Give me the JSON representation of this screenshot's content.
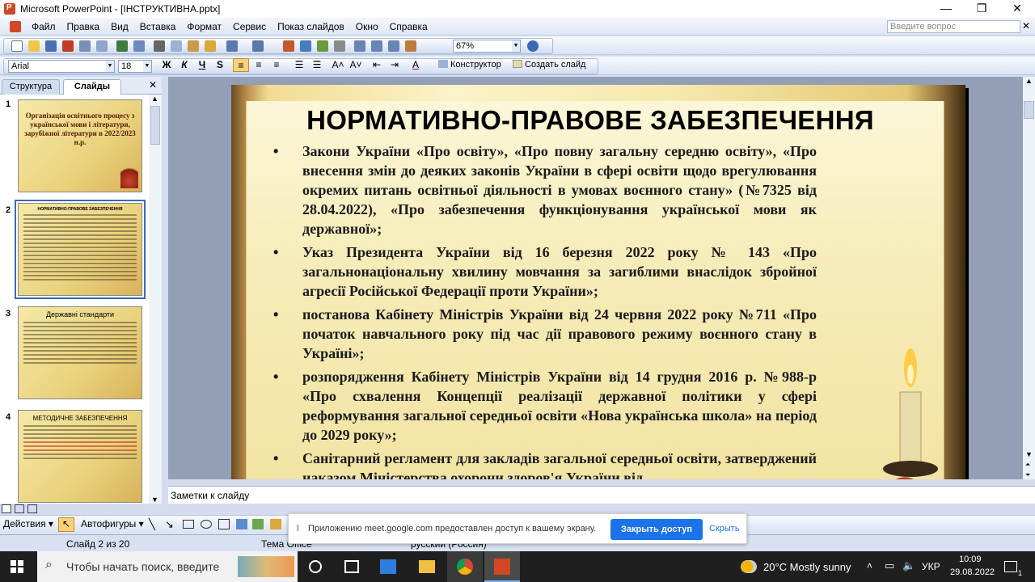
{
  "window": {
    "title": "Microsoft PowerPoint - [ІНСТРУКТИВНА.pptx]",
    "minimize": "—",
    "restore": "❐",
    "close": "✕"
  },
  "menu": {
    "items": [
      "Файл",
      "Правка",
      "Вид",
      "Вставка",
      "Формат",
      "Сервис",
      "Показ слайдов",
      "Окно",
      "Справка"
    ],
    "ask_placeholder": "Введите вопрос",
    "doc_close": "✕"
  },
  "toolbar": {
    "zoom": "67%",
    "font": "Arial",
    "size": "18",
    "bold": "Ж",
    "italic": "К",
    "underline": "Ч",
    "shadow": "S",
    "konstruktor": "Конструктор",
    "create_slide": "Создать слайд"
  },
  "leftpane": {
    "tab_structure": "Структура",
    "tab_slides": "Слайды",
    "close": "✕",
    "thumbs": [
      {
        "num": "1",
        "title": "Організація освітнього процесу з української мови і літератури, зарубіжної літератури в 2022/2023 н.р."
      },
      {
        "num": "2",
        "title": "НОРМАТИВНО-ПРАВОВЕ ЗАБЕЗПЕЧЕННЯ"
      },
      {
        "num": "3",
        "title": "Державні стандарти"
      },
      {
        "num": "4",
        "title": "МЕТОДИЧНЕ ЗАБЕЗПЕЧЕННЯ"
      }
    ]
  },
  "slide": {
    "title": "НОРМАТИВНО-ПРАВОВЕ ЗАБЕЗПЕЧЕННЯ",
    "bullets": [
      "Закони України «Про освіту», «Про повну загальну середню освіту», «Про внесення змін до деяких законів України в сфері освіти щодо врегулювання окремих питань освітньої діяльності в умовах воєнного стану» (№7325 від 28.04.2022), «Про забезпечення функціонування української мови як державної»;",
      "Указ Президента України від 16 березня 2022 року № 143 «Про загальнонаціональну хвилину мовчання за загиблими внаслідок збройної агресії Російської Федерації проти України»;",
      "постанова Кабінету Міністрів України від 24 червня 2022 року №711 «Про початок навчального року під час дії правового режиму воєнного стану в Україні»;",
      " розпорядження Кабінету Міністрів України від 14 грудня 2016 р. №988-р «Про схвалення Концепції реалізації державної політики у сфері реформування загальної середньої освіти «Нова українська школа» на період до 2029 року»;",
      " Санітарний регламент для закладів загальної середньої освіти, затверджений наказом Міністерства охорони здоров'я України від"
    ]
  },
  "notes": {
    "placeholder": "Заметки к слайду"
  },
  "drawbar": {
    "actions": "Действия",
    "autoshapes": "Автофигуры"
  },
  "status": {
    "slide": "Слайд 2 из 20",
    "theme": "Тема Office",
    "language": "русский (Россия)"
  },
  "share": {
    "message": "Приложению meet.google.com предоставлен доступ к вашему экрану.",
    "stop_button": "Закрыть доступ",
    "hide": "Скрыть"
  },
  "taskbar": {
    "search_placeholder": "Чтобы начать поиск, введите",
    "weather": "20°C  Mostly sunny",
    "lang": "УКР",
    "time": "10:09",
    "date": "29.08.2022",
    "notif_count": "1"
  },
  "colors": {
    "accent": "#1a73e8",
    "slide_title": "#000000",
    "ppt_orange": "#d24726"
  }
}
